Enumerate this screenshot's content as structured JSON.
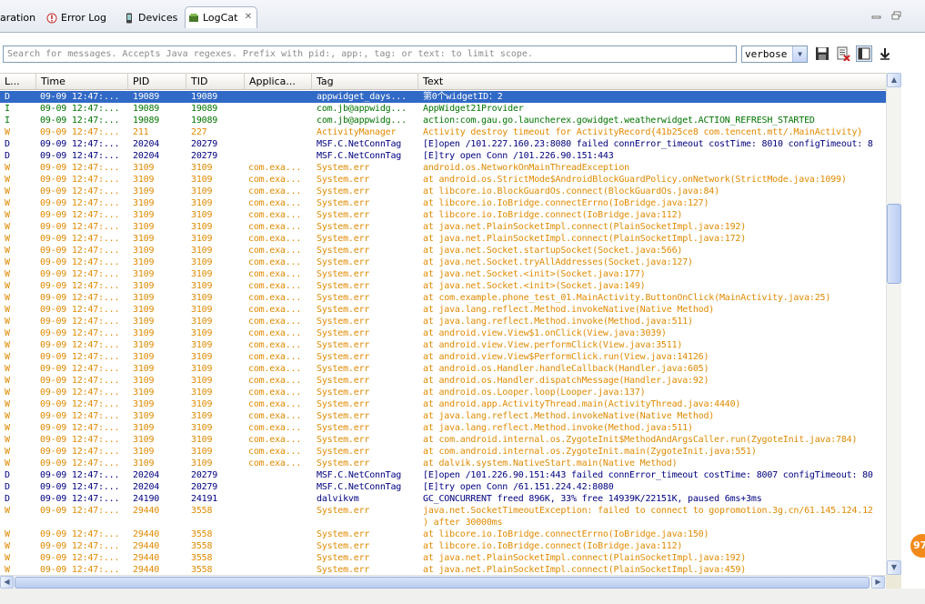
{
  "tabs": [
    {
      "label": "aration",
      "icon": "none"
    },
    {
      "label": "Error Log",
      "icon": "error-log-icon"
    },
    {
      "label": "Devices",
      "icon": "device-icon"
    },
    {
      "label": "LogCat",
      "icon": "logcat-icon",
      "active": true
    }
  ],
  "toolbar": {
    "search_placeholder": "Search for messages. Accepts Java regexes. Prefix with pid:, app:, tag: or text: to limit scope.",
    "log_level": "verbose"
  },
  "columns": [
    "L...",
    "Time",
    "PID",
    "TID",
    "Applica...",
    "Tag",
    "Text"
  ],
  "rows": [
    {
      "level": "D",
      "time": "09-09 12:47:...",
      "pid": "19089",
      "tid": "19089",
      "app": "",
      "tag": "appwidget_days...",
      "text": "第0个widgetID：2",
      "selected": true
    },
    {
      "level": "I",
      "time": "09-09 12:47:...",
      "pid": "19089",
      "tid": "19089",
      "app": "",
      "tag": "com.jb@appwidg...",
      "text": "AppWidget21Provider"
    },
    {
      "level": "I",
      "time": "09-09 12:47:...",
      "pid": "19089",
      "tid": "19089",
      "app": "",
      "tag": "com.jb@appwidg...",
      "text": "action:com.gau.go.launcherex.gowidget.weatherwidget.ACTION_REFRESH_STARTED"
    },
    {
      "level": "W",
      "time": "09-09 12:47:...",
      "pid": "211",
      "tid": "227",
      "app": "",
      "tag": "ActivityManager",
      "text": "Activity destroy timeout for ActivityRecord{41b25ce8 com.tencent.mtt/.MainActivity}"
    },
    {
      "level": "D",
      "time": "09-09 12:47:...",
      "pid": "20204",
      "tid": "20279",
      "app": "",
      "tag": "MSF.C.NetConnTag",
      "text": "[E]open /101.227.160.23:8080 failed connError_timeout costTime: 8010 configTimeout: 8"
    },
    {
      "level": "D",
      "time": "09-09 12:47:...",
      "pid": "20204",
      "tid": "20279",
      "app": "",
      "tag": "MSF.C.NetConnTag",
      "text": "[E]try open Conn /101.226.90.151:443"
    },
    {
      "level": "W",
      "time": "09-09 12:47:...",
      "pid": "3109",
      "tid": "3109",
      "app": "com.exa...",
      "tag": "System.err",
      "text": "android.os.NetworkOnMainThreadException"
    },
    {
      "level": "W",
      "time": "09-09 12:47:...",
      "pid": "3109",
      "tid": "3109",
      "app": "com.exa...",
      "tag": "System.err",
      "text": "at android.os.StrictMode$AndroidBlockGuardPolicy.onNetwork(StrictMode.java:1099)"
    },
    {
      "level": "W",
      "time": "09-09 12:47:...",
      "pid": "3109",
      "tid": "3109",
      "app": "com.exa...",
      "tag": "System.err",
      "text": "at libcore.io.BlockGuardOs.connect(BlockGuardOs.java:84)"
    },
    {
      "level": "W",
      "time": "09-09 12:47:...",
      "pid": "3109",
      "tid": "3109",
      "app": "com.exa...",
      "tag": "System.err",
      "text": "at libcore.io.IoBridge.connectErrno(IoBridge.java:127)"
    },
    {
      "level": "W",
      "time": "09-09 12:47:...",
      "pid": "3109",
      "tid": "3109",
      "app": "com.exa...",
      "tag": "System.err",
      "text": "at libcore.io.IoBridge.connect(IoBridge.java:112)"
    },
    {
      "level": "W",
      "time": "09-09 12:47:...",
      "pid": "3109",
      "tid": "3109",
      "app": "com.exa...",
      "tag": "System.err",
      "text": "at java.net.PlainSocketImpl.connect(PlainSocketImpl.java:192)"
    },
    {
      "level": "W",
      "time": "09-09 12:47:...",
      "pid": "3109",
      "tid": "3109",
      "app": "com.exa...",
      "tag": "System.err",
      "text": "at java.net.PlainSocketImpl.connect(PlainSocketImpl.java:172)"
    },
    {
      "level": "W",
      "time": "09-09 12:47:...",
      "pid": "3109",
      "tid": "3109",
      "app": "com.exa...",
      "tag": "System.err",
      "text": "at java.net.Socket.startupSocket(Socket.java:566)"
    },
    {
      "level": "W",
      "time": "09-09 12:47:...",
      "pid": "3109",
      "tid": "3109",
      "app": "com.exa...",
      "tag": "System.err",
      "text": "at java.net.Socket.tryAllAddresses(Socket.java:127)"
    },
    {
      "level": "W",
      "time": "09-09 12:47:...",
      "pid": "3109",
      "tid": "3109",
      "app": "com.exa...",
      "tag": "System.err",
      "text": "at java.net.Socket.<init>(Socket.java:177)"
    },
    {
      "level": "W",
      "time": "09-09 12:47:...",
      "pid": "3109",
      "tid": "3109",
      "app": "com.exa...",
      "tag": "System.err",
      "text": "at java.net.Socket.<init>(Socket.java:149)"
    },
    {
      "level": "W",
      "time": "09-09 12:47:...",
      "pid": "3109",
      "tid": "3109",
      "app": "com.exa...",
      "tag": "System.err",
      "text": "at com.example.phone_test_01.MainActivity.ButtonOnClick(MainActivity.java:25)"
    },
    {
      "level": "W",
      "time": "09-09 12:47:...",
      "pid": "3109",
      "tid": "3109",
      "app": "com.exa...",
      "tag": "System.err",
      "text": "at java.lang.reflect.Method.invokeNative(Native Method)"
    },
    {
      "level": "W",
      "time": "09-09 12:47:...",
      "pid": "3109",
      "tid": "3109",
      "app": "com.exa...",
      "tag": "System.err",
      "text": "at java.lang.reflect.Method.invoke(Method.java:511)"
    },
    {
      "level": "W",
      "time": "09-09 12:47:...",
      "pid": "3109",
      "tid": "3109",
      "app": "com.exa...",
      "tag": "System.err",
      "text": "at android.view.View$1.onClick(View.java:3039)"
    },
    {
      "level": "W",
      "time": "09-09 12:47:...",
      "pid": "3109",
      "tid": "3109",
      "app": "com.exa...",
      "tag": "System.err",
      "text": "at android.view.View.performClick(View.java:3511)"
    },
    {
      "level": "W",
      "time": "09-09 12:47:...",
      "pid": "3109",
      "tid": "3109",
      "app": "com.exa...",
      "tag": "System.err",
      "text": "at android.view.View$PerformClick.run(View.java:14126)"
    },
    {
      "level": "W",
      "time": "09-09 12:47:...",
      "pid": "3109",
      "tid": "3109",
      "app": "com.exa...",
      "tag": "System.err",
      "text": "at android.os.Handler.handleCallback(Handler.java:605)"
    },
    {
      "level": "W",
      "time": "09-09 12:47:...",
      "pid": "3109",
      "tid": "3109",
      "app": "com.exa...",
      "tag": "System.err",
      "text": "at android.os.Handler.dispatchMessage(Handler.java:92)"
    },
    {
      "level": "W",
      "time": "09-09 12:47:...",
      "pid": "3109",
      "tid": "3109",
      "app": "com.exa...",
      "tag": "System.err",
      "text": "at android.os.Looper.loop(Looper.java:137)"
    },
    {
      "level": "W",
      "time": "09-09 12:47:...",
      "pid": "3109",
      "tid": "3109",
      "app": "com.exa...",
      "tag": "System.err",
      "text": "at android.app.ActivityThread.main(ActivityThread.java:4440)"
    },
    {
      "level": "W",
      "time": "09-09 12:47:...",
      "pid": "3109",
      "tid": "3109",
      "app": "com.exa...",
      "tag": "System.err",
      "text": "at java.lang.reflect.Method.invokeNative(Native Method)"
    },
    {
      "level": "W",
      "time": "09-09 12:47:...",
      "pid": "3109",
      "tid": "3109",
      "app": "com.exa...",
      "tag": "System.err",
      "text": "at java.lang.reflect.Method.invoke(Method.java:511)"
    },
    {
      "level": "W",
      "time": "09-09 12:47:...",
      "pid": "3109",
      "tid": "3109",
      "app": "com.exa...",
      "tag": "System.err",
      "text": "at com.android.internal.os.ZygoteInit$MethodAndArgsCaller.run(ZygoteInit.java:784)"
    },
    {
      "level": "W",
      "time": "09-09 12:47:...",
      "pid": "3109",
      "tid": "3109",
      "app": "com.exa...",
      "tag": "System.err",
      "text": "at com.android.internal.os.ZygoteInit.main(ZygoteInit.java:551)"
    },
    {
      "level": "W",
      "time": "09-09 12:47:...",
      "pid": "3109",
      "tid": "3109",
      "app": "com.exa...",
      "tag": "System.err",
      "text": "at dalvik.system.NativeStart.main(Native Method)"
    },
    {
      "level": "D",
      "time": "09-09 12:47:...",
      "pid": "20204",
      "tid": "20279",
      "app": "",
      "tag": "MSF.C.NetConnTag",
      "text": "[E]open /101.226.90.151:443 failed connError_timeout costTime: 8007 configTimeout: 80"
    },
    {
      "level": "D",
      "time": "09-09 12:47:...",
      "pid": "20204",
      "tid": "20279",
      "app": "",
      "tag": "MSF.C.NetConnTag",
      "text": "[E]try open Conn /61.151.224.42:8080"
    },
    {
      "level": "D",
      "time": "09-09 12:47:...",
      "pid": "24190",
      "tid": "24191",
      "app": "",
      "tag": "dalvikvm",
      "text": "GC_CONCURRENT freed 896K, 33% free 14939K/22151K, paused 6ms+3ms"
    },
    {
      "level": "W",
      "time": "09-09 12:47:...",
      "pid": "29440",
      "tid": "3558",
      "app": "",
      "tag": "System.err",
      "text": "java.net.SocketTimeoutException: failed to connect to gopromotion.3g.cn/61.145.124.12"
    },
    {
      "level": "",
      "time": "",
      "pid": "",
      "tid": "",
      "app": "",
      "tag": "",
      "text": ") after 30000ms",
      "cont": true
    },
    {
      "level": "W",
      "time": "09-09 12:47:...",
      "pid": "29440",
      "tid": "3558",
      "app": "",
      "tag": "System.err",
      "text": "at libcore.io.IoBridge.connectErrno(IoBridge.java:150)"
    },
    {
      "level": "W",
      "time": "09-09 12:47:...",
      "pid": "29440",
      "tid": "3558",
      "app": "",
      "tag": "System.err",
      "text": "at libcore.io.IoBridge.connect(IoBridge.java:112)"
    },
    {
      "level": "W",
      "time": "09-09 12:47:...",
      "pid": "29440",
      "tid": "3558",
      "app": "",
      "tag": "System.err",
      "text": "at java.net.PlainSocketImpl.connect(PlainSocketImpl.java:192)"
    },
    {
      "level": "W",
      "time": "09-09 12:47:...",
      "pid": "29440",
      "tid": "3558",
      "app": "",
      "tag": "System.err",
      "text": "at java.net.PlainSocketImpl.connect(PlainSocketImpl.java:459)"
    }
  ],
  "badge": "97",
  "colors": {
    "debug": "#000080",
    "info": "#007400",
    "warn": "#e08a00",
    "selection": "#3169c6"
  }
}
